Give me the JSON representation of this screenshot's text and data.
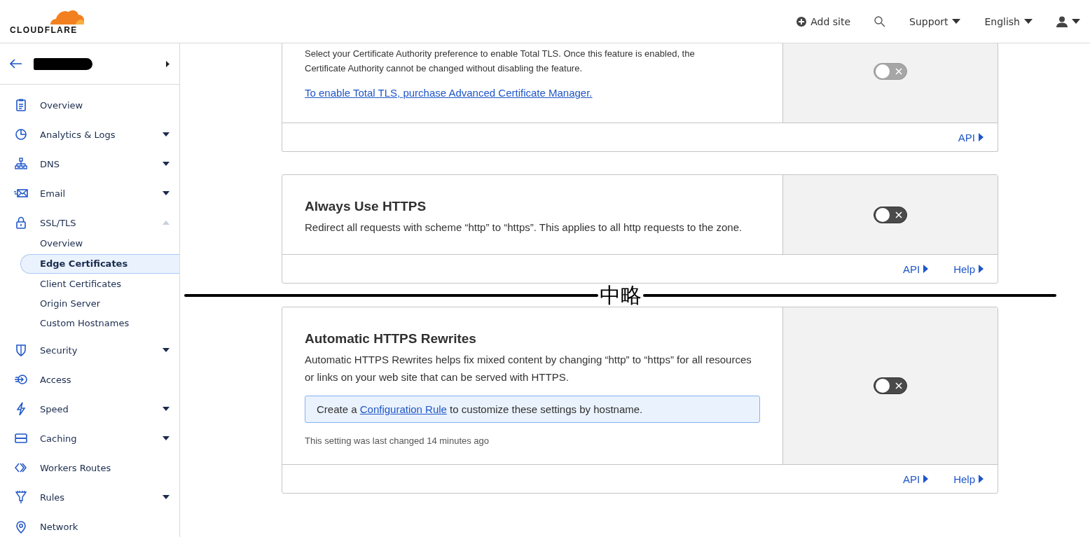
{
  "header": {
    "logo_text": "CLOUDFLARE",
    "add_site": "Add site",
    "support": "Support",
    "language": "English"
  },
  "sidebar": {
    "items": [
      {
        "label": "Overview",
        "kind": "link"
      },
      {
        "label": "Analytics & Logs",
        "kind": "menu",
        "expanded": false
      },
      {
        "label": "DNS",
        "kind": "menu",
        "expanded": false
      },
      {
        "label": "Email",
        "kind": "menu",
        "expanded": false
      },
      {
        "label": "SSL/TLS",
        "kind": "menu",
        "expanded": true,
        "children": [
          {
            "label": "Overview",
            "selected": false
          },
          {
            "label": "Edge Certificates",
            "selected": true
          },
          {
            "label": "Client Certificates",
            "selected": false
          },
          {
            "label": "Origin Server",
            "selected": false
          },
          {
            "label": "Custom Hostnames",
            "selected": false
          }
        ]
      },
      {
        "label": "Security",
        "kind": "menu",
        "expanded": false
      },
      {
        "label": "Access",
        "kind": "link"
      },
      {
        "label": "Speed",
        "kind": "menu",
        "expanded": false
      },
      {
        "label": "Caching",
        "kind": "menu",
        "expanded": false
      },
      {
        "label": "Workers Routes",
        "kind": "link"
      },
      {
        "label": "Rules",
        "kind": "menu",
        "expanded": false
      },
      {
        "label": "Network",
        "kind": "link"
      }
    ]
  },
  "cards": [
    {
      "description": "Select your Certificate Authority preference to enable Total TLS. Once this feature is enabled, the Certificate Authority cannot be changed without disabling the feature.",
      "link": "To enable Total TLS, purchase Advanced Certificate Manager.",
      "on": false,
      "disabled": true,
      "footer_links": [
        "API"
      ]
    },
    {
      "title": "Always Use HTTPS",
      "description": "Redirect all requests with scheme “http” to “https”. This applies to all http requests to the zone.",
      "on": false,
      "disabled": false,
      "footer_links": [
        "API",
        "Help"
      ]
    },
    {
      "title": "Automatic HTTPS Rewrites",
      "description": "Automatic HTTPS Rewrites helps fix mixed content by changing “http” to “https” for all resources or links on your web site that can be served with HTTPS.",
      "info": {
        "before": "Create a ",
        "link": "Configuration Rule",
        "after": " to customize these settings by hostname."
      },
      "note": "This setting was last changed 14 minutes ago",
      "on": false,
      "disabled": false,
      "footer_links": [
        "API",
        "Help"
      ]
    }
  ],
  "annotation": "中略"
}
